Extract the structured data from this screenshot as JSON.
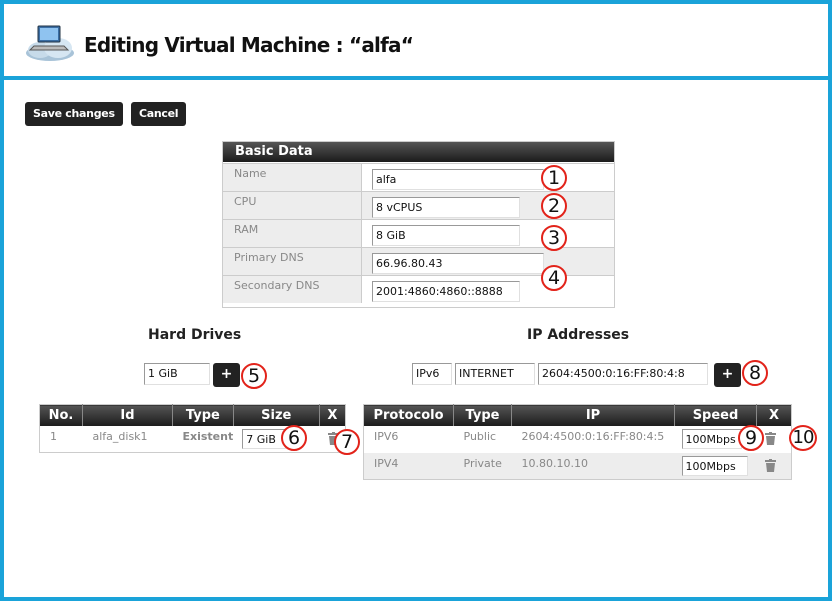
{
  "window": {
    "title": "Editing Virtual Machine : “alfa“",
    "icon": "cloud-computer-icon"
  },
  "toolbar": {
    "save_label": "Save changes",
    "cancel_label": "Cancel"
  },
  "basic_data": {
    "heading": "Basic Data",
    "rows": [
      {
        "label": "Name",
        "value": "alfa",
        "marker": "1"
      },
      {
        "label": "CPU",
        "value": "8 vCPUS",
        "marker": "2"
      },
      {
        "label": "RAM",
        "value": "8 GiB",
        "marker": "3"
      },
      {
        "label": "Primary DNS",
        "value": "66.96.80.43",
        "marker": "4"
      },
      {
        "label": "Secondary DNS",
        "value": "2001:4860:4860::8888"
      }
    ]
  },
  "hard_drives": {
    "heading": "Hard Drives",
    "new_size": "1 GiB",
    "add_label": "+",
    "add_marker": "5",
    "columns": [
      "No.",
      "Id",
      "Type",
      "Size",
      "X"
    ],
    "rows": [
      {
        "no": "1",
        "id": "alfa_disk1",
        "type": "Existent",
        "size": "7 GiB",
        "size_marker": "6",
        "delete_marker": "7"
      }
    ]
  },
  "ip_addresses": {
    "heading": "IP Addresses",
    "new_version": "IPv6",
    "new_type": "INTERNET",
    "new_ip": "2604:4500:0:16:FF:80:4:8",
    "add_label": "+",
    "add_marker": "8",
    "columns": [
      "Protocolo",
      "Type",
      "IP",
      "Speed",
      "X"
    ],
    "rows": [
      {
        "protocol": "IPV6",
        "type": "Public",
        "ip": "2604:4500:0:16:FF:80:4:5",
        "speed": "100Mbps",
        "speed_marker": "9",
        "delete_marker": "10"
      },
      {
        "protocol": "IPV4",
        "type": "Private",
        "ip": "10.80.10.10",
        "speed": "100Mbps"
      }
    ]
  },
  "colors": {
    "frame": "#1aa3d9",
    "header_bar": "#1b1b1b",
    "marker_ring": "#e2231a",
    "alt_row": "#ededed"
  }
}
